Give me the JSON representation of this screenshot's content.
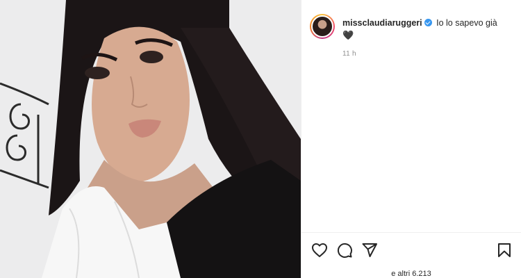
{
  "post": {
    "username": "missclaudiaruggeri",
    "caption": "Io lo sapevo già",
    "caption_emoji": "🖤",
    "time": "11 h",
    "likes_text": "e altri 6.213"
  },
  "icons": {
    "like": "heart-outline-icon",
    "comment": "comment-bubble-icon",
    "share": "paper-plane-icon",
    "save": "bookmark-icon",
    "verified": "verified-badge-icon"
  },
  "colors": {
    "verified": "#3897f0",
    "text": "#262626",
    "muted": "#8e8e8e"
  }
}
